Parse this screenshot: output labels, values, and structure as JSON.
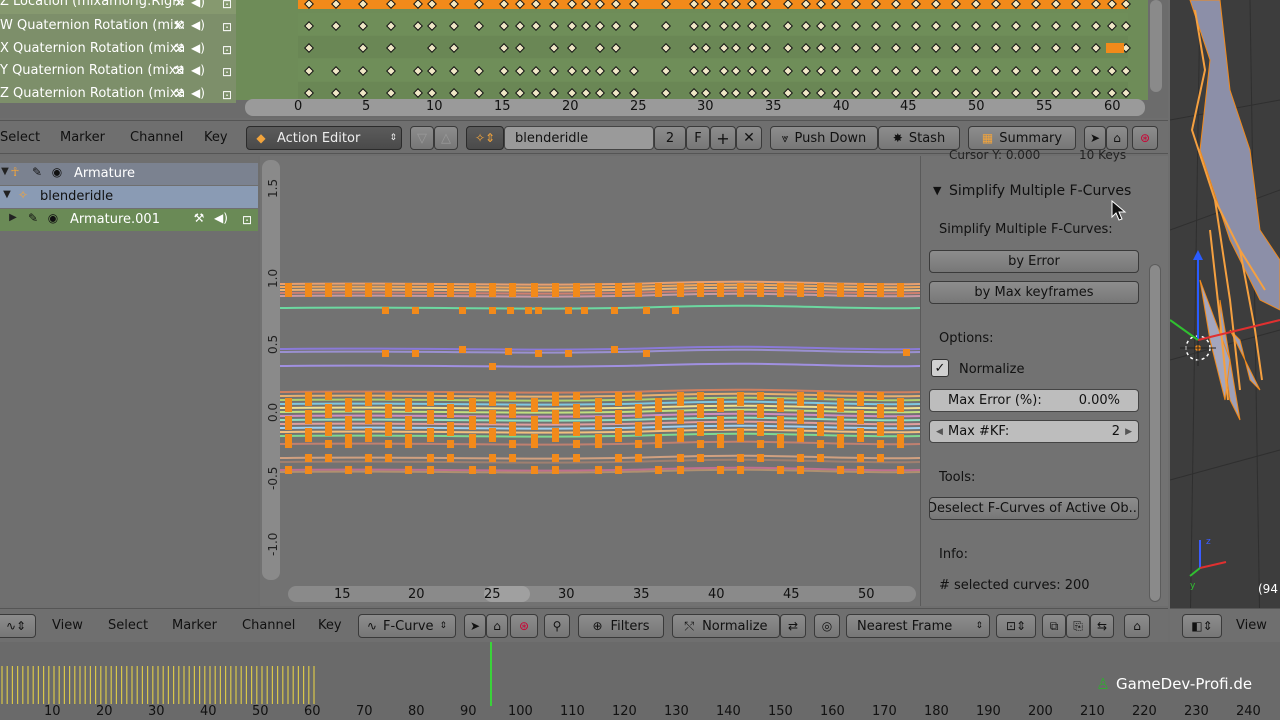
{
  "dopesheet": {
    "channels": [
      {
        "label": "Z Location (mixamorig:RightHand)",
        "selected": true
      },
      {
        "label": "W Quaternion Rotation (mixamorig:RightHand)",
        "selected": false
      },
      {
        "label": "X Quaternion Rotation (mixamorig:RightHand)",
        "selected": false
      },
      {
        "label": "Y Quaternion Rotation (mixamorig:RightHand)",
        "selected": false
      },
      {
        "label": "Z Quaternion Rotation (mixamorig:RightHand)",
        "selected": false
      }
    ],
    "ruler_labels": [
      "0",
      "5",
      "10",
      "15",
      "20",
      "25",
      "30",
      "35",
      "40",
      "45",
      "50",
      "55",
      "60"
    ]
  },
  "action_header": {
    "menus": [
      "Select",
      "Marker",
      "Channel",
      "Key"
    ],
    "mode": "Action Editor",
    "action_name": "blenderidle",
    "users": "2",
    "fake_user": "F",
    "push_down": "Push Down",
    "stash": "Stash",
    "summary": "Summary"
  },
  "graph_channels": [
    {
      "label": "Armature",
      "level": 0
    },
    {
      "label": "blenderidle",
      "level": 1
    },
    {
      "label": "Armature.001",
      "level": 1
    }
  ],
  "graph": {
    "y_labels": [
      "1.5",
      "1.0",
      "0.5",
      "0.0",
      "-0.5",
      "-1.0"
    ],
    "x_labels": [
      "15",
      "20",
      "25",
      "30",
      "35",
      "40",
      "45",
      "50"
    ],
    "current_frame": "25"
  },
  "panel": {
    "clipped_top": "Cursor Y:   0.000",
    "clipped_top2": "10 Keys",
    "section_title": "Simplify Multiple F-Curves",
    "subtitle": "Simplify Multiple F-Curves:",
    "by_error": "by Error",
    "by_max": "by Max keyframes",
    "options": "Options:",
    "normalize": "Normalize",
    "max_error_label": "Max Error (%):",
    "max_error_value": "0.00%",
    "max_kf_label": "Max #KF:",
    "max_kf_value": "2",
    "tools": "Tools:",
    "deselect": "Deselect F-Curves of Active Ob...",
    "info": "Info:",
    "selected_curves": "# selected curves: 200"
  },
  "graph_header": {
    "menus": [
      "View",
      "Select",
      "Marker",
      "Channel",
      "Key"
    ],
    "mode": "F-Curve",
    "filters": "Filters",
    "normalize": "Normalize",
    "pivot": "Nearest Frame",
    "view3d_view": "View"
  },
  "timeline": {
    "labels": [
      "10",
      "20",
      "30",
      "40",
      "50",
      "60",
      "70",
      "80",
      "90",
      "100",
      "110",
      "120",
      "130",
      "140",
      "150",
      "160",
      "170",
      "180",
      "190",
      "200",
      "210",
      "220",
      "230",
      "240"
    ]
  },
  "viewport": {
    "coord": "(94"
  },
  "watermark": "GameDev-Profi.de",
  "colors": {
    "orange": "#f28a1a",
    "green_row": "#6f8f58",
    "keyframe_yellow": "#d8c64a"
  }
}
